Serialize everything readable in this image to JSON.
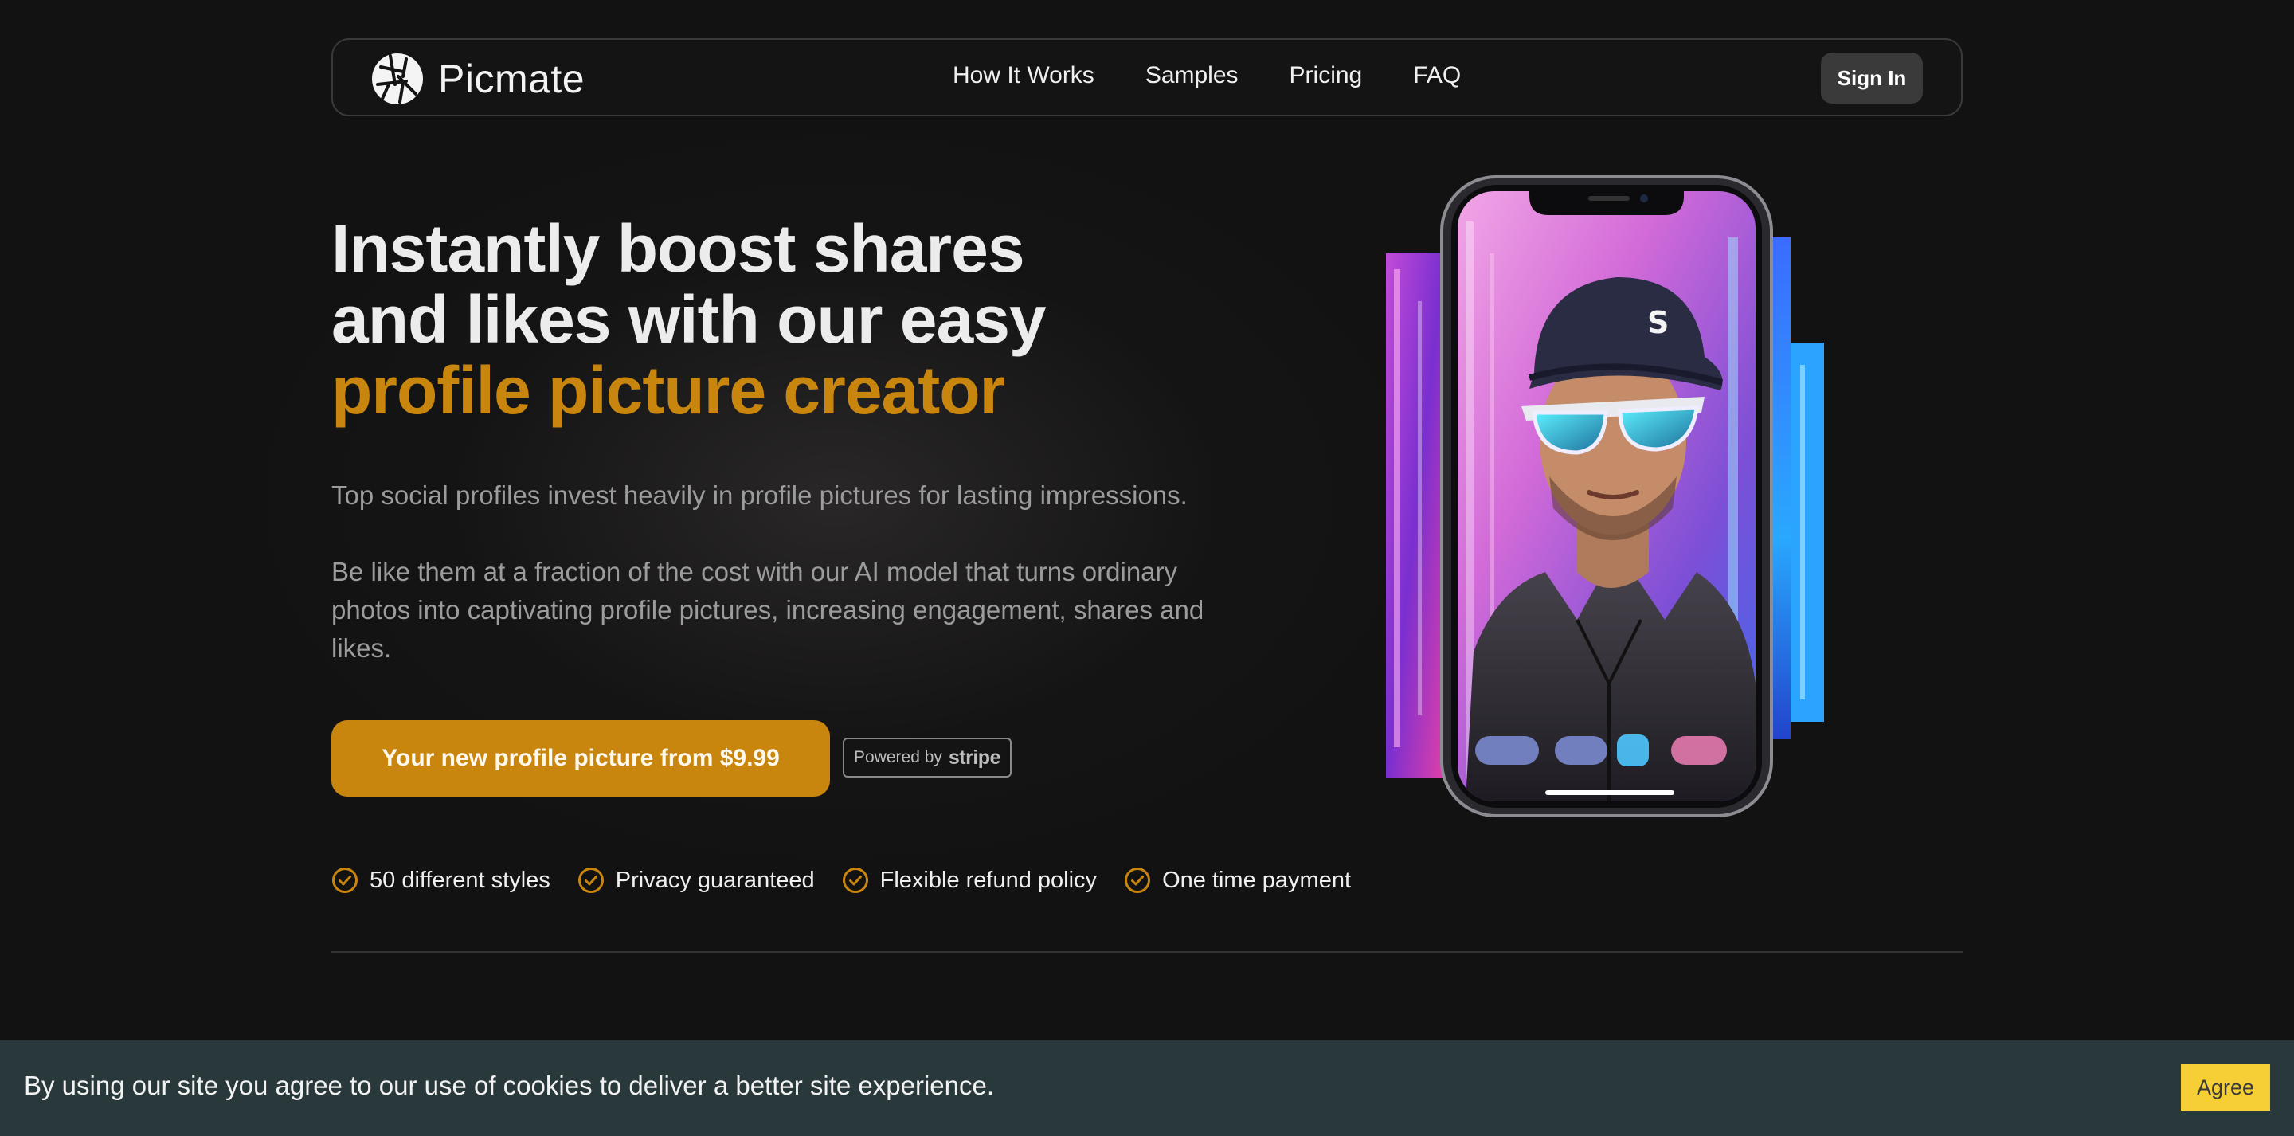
{
  "nav": {
    "brand": "Picmate",
    "links": [
      "How It Works",
      "Samples",
      "Pricing",
      "FAQ"
    ],
    "sign_in": "Sign In"
  },
  "hero": {
    "headline_line1": "Instantly boost shares",
    "headline_line2": "and likes with our easy",
    "headline_accent": "profile picture creator",
    "paragraph1": "Top social profiles invest heavily in profile pictures for lasting impressions.",
    "paragraph2": "Be like them at a fraction of the cost with our AI model that turns ordinary photos into captivating profile pictures, increasing engagement, shares and likes.",
    "cta": "Your new profile picture from $9.99",
    "powered_by": "Powered by",
    "stripe": "stripe",
    "features": [
      "50 different styles",
      "Privacy guaranteed",
      "Flexible refund policy",
      "One time payment"
    ]
  },
  "cookie": {
    "text": "By using our site you agree to our use of cookies to deliver a better site experience.",
    "agree": "Agree"
  },
  "colors": {
    "accent": "#c8860f",
    "background": "#121212",
    "cookie_bar": "#29383a",
    "agree_button": "#f5cf35"
  },
  "icons": [
    "picmate-logo-icon",
    "check-circle-icon"
  ]
}
